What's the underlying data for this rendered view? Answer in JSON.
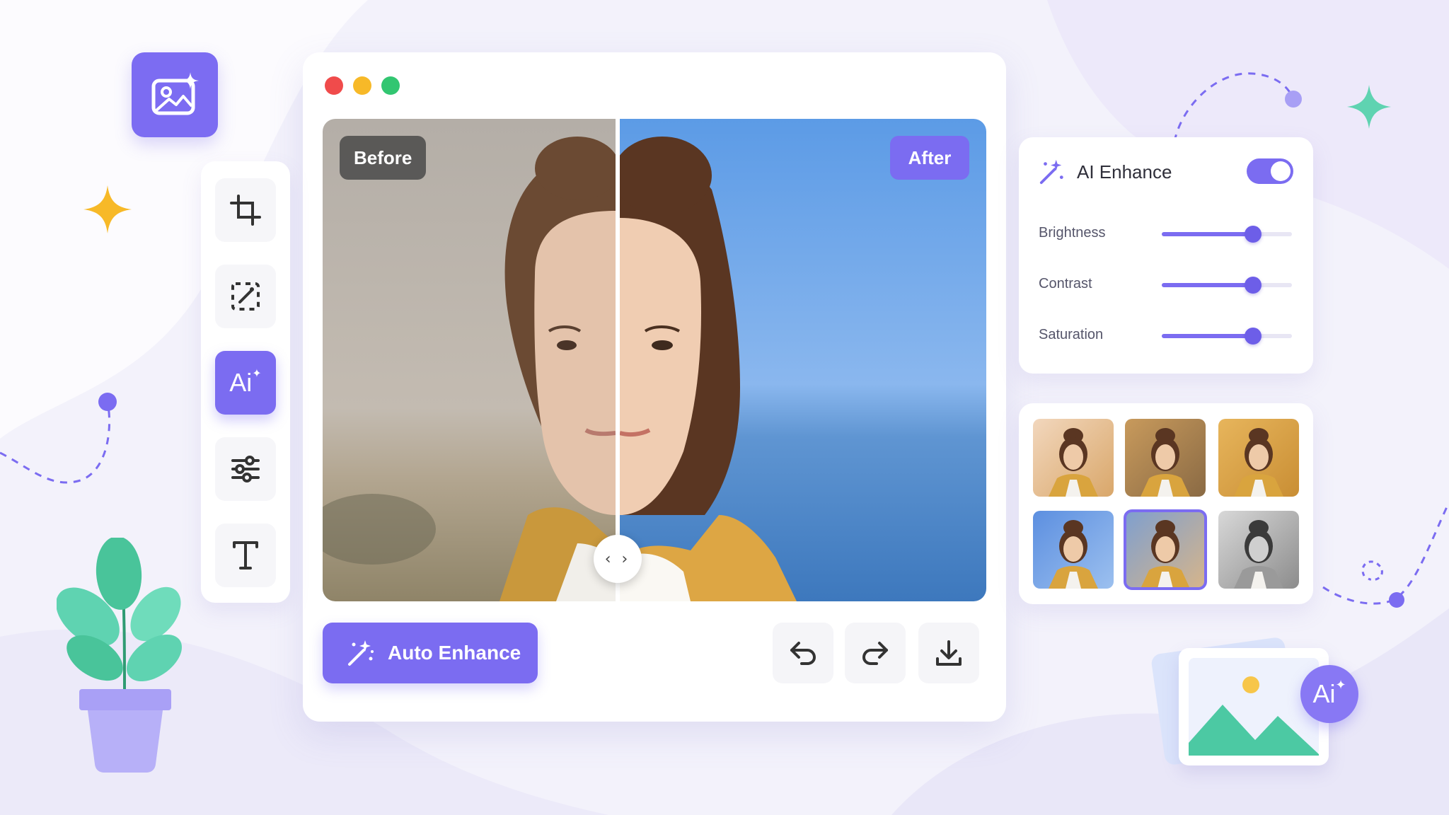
{
  "photo": {
    "before_label": "Before",
    "after_label": "After"
  },
  "tool_rail": {
    "items": [
      {
        "name": "crop",
        "active": false
      },
      {
        "name": "magic-select",
        "active": false
      },
      {
        "name": "ai",
        "active": true,
        "text": "Ai"
      },
      {
        "name": "adjust",
        "active": false
      },
      {
        "name": "text",
        "active": false
      }
    ]
  },
  "actions": {
    "auto_enhance_label": "Auto Enhance"
  },
  "settings": {
    "title": "AI Enhance",
    "enabled": true,
    "sliders": [
      {
        "label": "Brightness",
        "value": 0.7
      },
      {
        "label": "Contrast",
        "value": 0.7
      },
      {
        "label": "Saturation",
        "value": 0.7
      }
    ]
  },
  "filters": {
    "selected_index": 4,
    "items": [
      "warm-light",
      "golden",
      "amber",
      "cool-blue",
      "natural",
      "monochrome"
    ]
  },
  "decor": {
    "ai_badge_text": "Ai"
  },
  "colors": {
    "accent": "#7b6cf1",
    "background": "#f3f2fb",
    "teal": "#4cc9a3",
    "gold": "#f7b928"
  }
}
